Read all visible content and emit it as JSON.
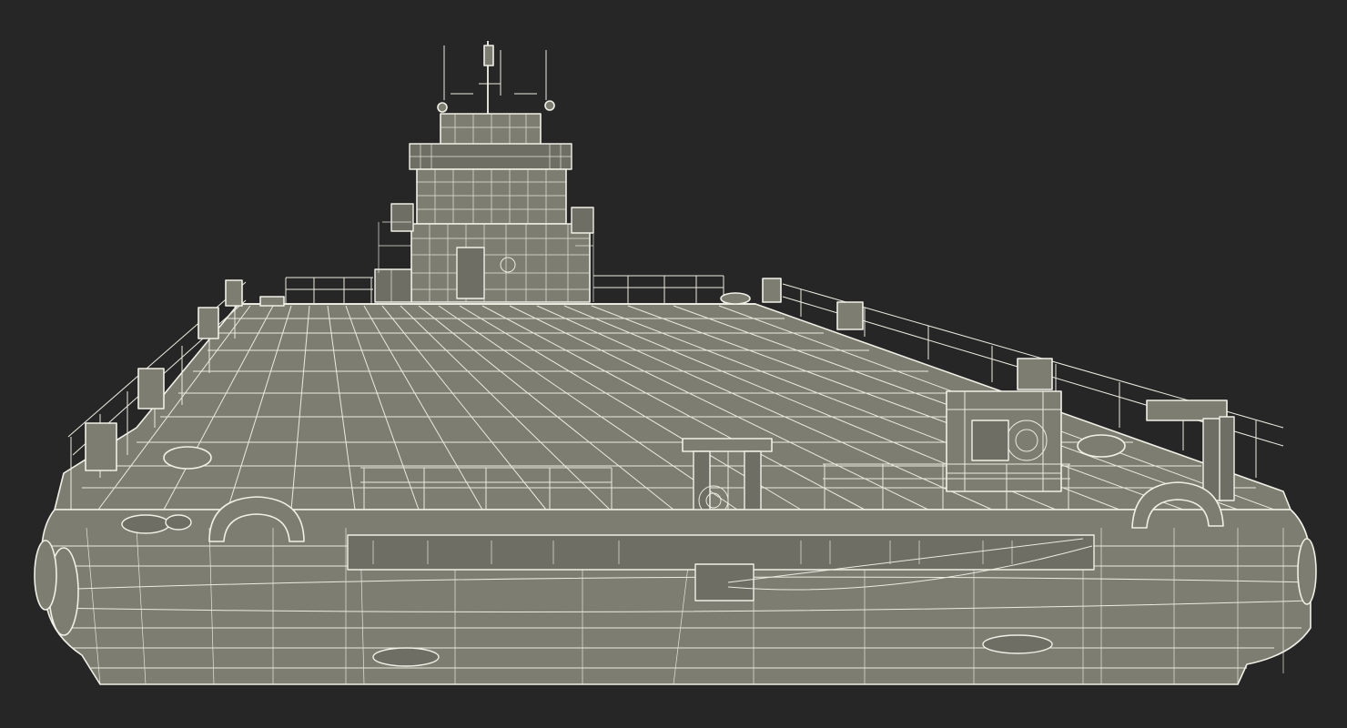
{
  "scene": {
    "subject": "barge-with-pilot-house",
    "render_style": "wireframe",
    "colors": {
      "background": "#262626",
      "surface": "#7d7d72",
      "surface_dark": "#6e6e64",
      "wire": "#f1f0e6"
    }
  }
}
